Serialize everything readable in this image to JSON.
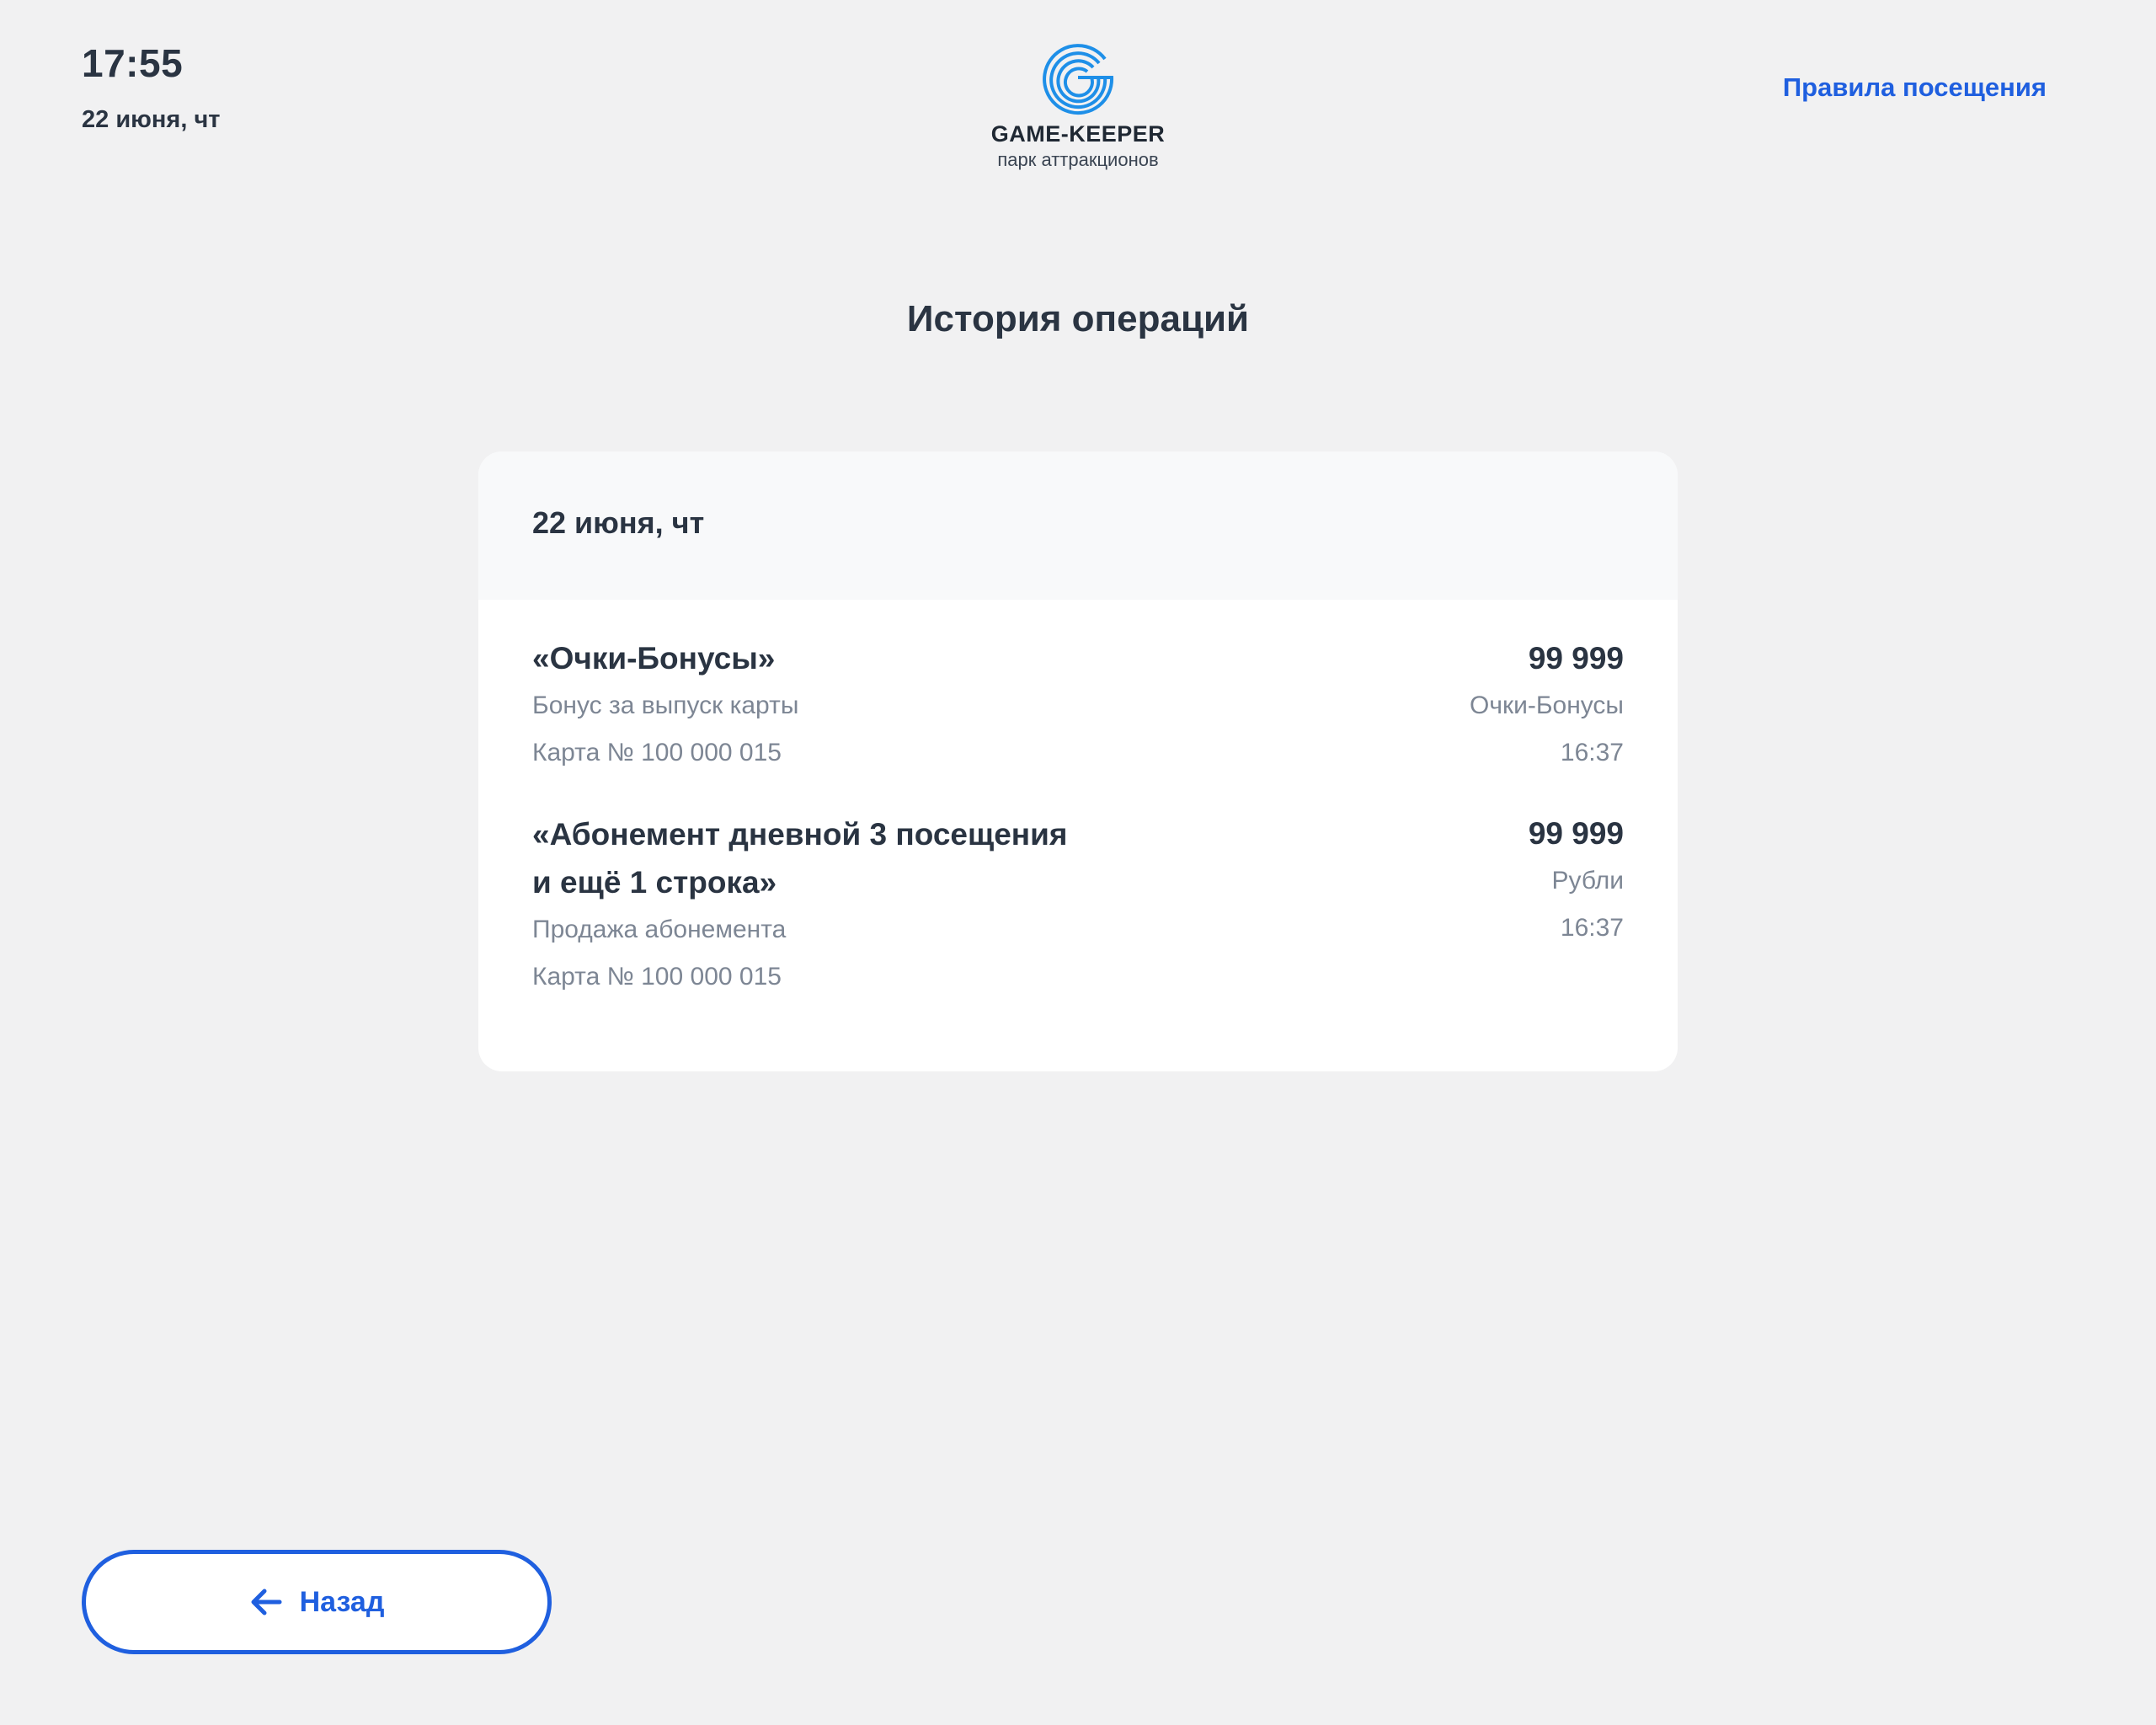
{
  "header": {
    "time": "17:55",
    "date": "22 июня, чт",
    "logo_name": "GAME-KEEPER",
    "logo_subtitle": "парк аттракционов",
    "rules_link": "Правила посещения"
  },
  "page": {
    "title": "История операций"
  },
  "history": {
    "group_date": "22 июня, чт",
    "operations": [
      {
        "title": "«Очки-Бонусы»",
        "description": "Бонус за выпуск карты",
        "card": "Карта № 100 000 015",
        "amount": "99 999",
        "currency": "Очки-Бонусы",
        "time": "16:37"
      },
      {
        "title_line1": "«Абонемент дневной 3 посещения",
        "title_line2": "и ещё 1 строка»",
        "description": "Продажа абонемента",
        "card": "Карта № 100 000 015",
        "amount": "99 999",
        "currency": "Рубли",
        "time": "16:37"
      }
    ]
  },
  "footer": {
    "back_label": "Назад"
  },
  "colors": {
    "accent": "#1f5fdf",
    "logo_blue": "#1e8fe8",
    "text_primary": "#2a3442",
    "text_secondary": "#7d8694",
    "background": "#f1f1f2",
    "card_header": "#f8f9fa"
  },
  "icons": {
    "logo": "game-keeper-logo-icon",
    "back": "arrow-left-icon"
  }
}
